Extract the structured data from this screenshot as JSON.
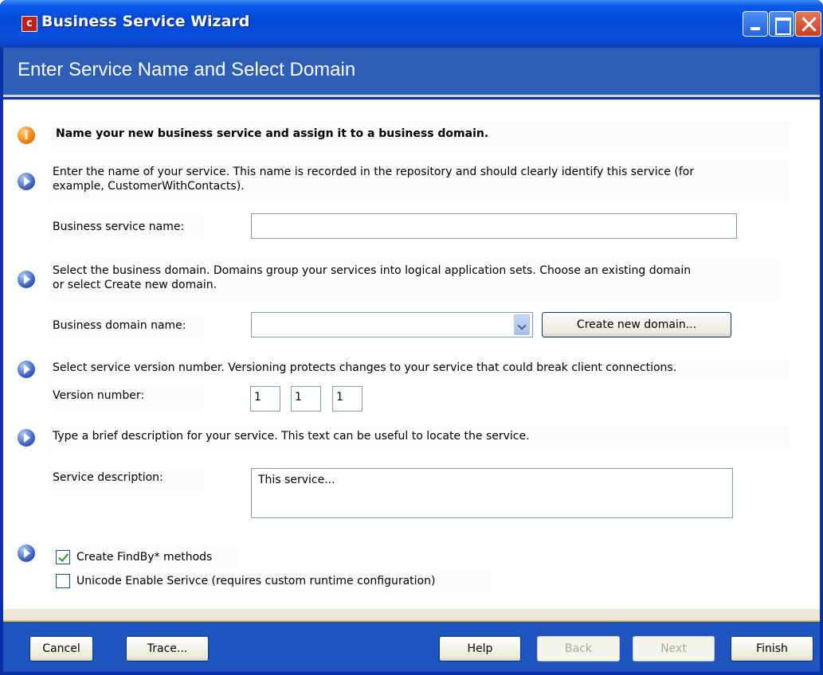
{
  "window": {
    "title": "Business Service Wizard",
    "app_icon": "c-icon"
  },
  "header": {
    "title": "Enter Service Name and Select Domain"
  },
  "intro": {
    "text": "Name your new business service and assign it to a business domain."
  },
  "service_name": {
    "description_line1": "Enter the name of your service. This name is recorded in the repository and should clearly identify this service (for",
    "description_line2": "example, CustomerWithContacts).",
    "label": "Business service name:",
    "value": ""
  },
  "domain": {
    "description_line1": "Select the business domain. Domains group your services into logical application sets. Choose an existing domain",
    "description_line2": "or select Create new domain.",
    "label": "Business domain name:",
    "value": "",
    "create_button": "Create new domain..."
  },
  "version": {
    "description": "Select service version number. Versioning protects changes to your service that could break client connections.",
    "label": "Version number:",
    "major": "1",
    "minor": "1",
    "patch": "1"
  },
  "description_section": {
    "description": "Type a brief description for your service. This text can be useful to locate the service.",
    "label": "Service description:",
    "value": "This service..."
  },
  "options": {
    "findby_label": "Create FindBy* methods",
    "findby_checked": true,
    "unicode_label": "Unicode Enable Serivce (requires custom runtime configuration)",
    "unicode_checked": false
  },
  "footer": {
    "cancel": "Cancel",
    "trace": "Trace...",
    "help": "Help",
    "back": "Back",
    "next": "Next",
    "finish": "Finish"
  },
  "colors": {
    "titlebar": "#0349d8",
    "header_band": "#2e5fb8",
    "bottom_bar": "#1e54c0"
  }
}
